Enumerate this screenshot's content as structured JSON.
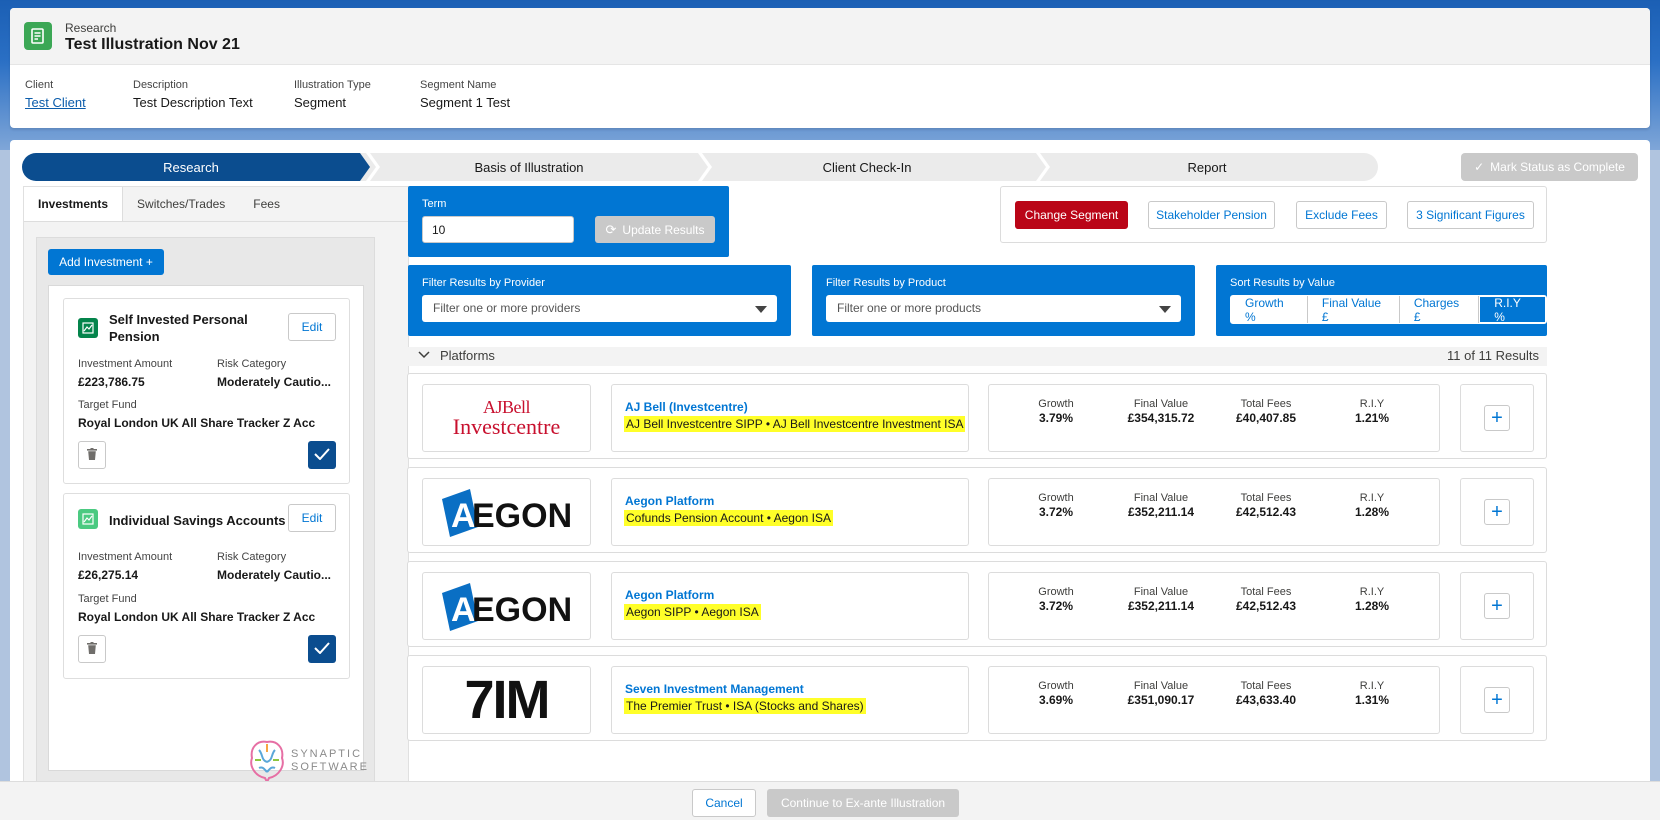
{
  "header": {
    "object_label": "Research",
    "title": "Test Illustration Nov 21",
    "fields": [
      {
        "label": "Client",
        "value": "Test Client"
      },
      {
        "label": "Description",
        "value": "Test Description Text"
      },
      {
        "label": "Illustration Type",
        "value": "Segment"
      },
      {
        "label": "Segment Name",
        "value": "Segment 1 Test"
      }
    ]
  },
  "path": {
    "steps": [
      "Research",
      "Basis of Illustration",
      "Client Check-In",
      "Report"
    ],
    "complete_label": "Mark Status as Complete"
  },
  "left_tabs": [
    "Investments",
    "Switches/Trades",
    "Fees"
  ],
  "add_investment_label": "Add Investment +",
  "investments": [
    {
      "title": "Self Invested Personal Pension",
      "edit_label": "Edit",
      "amount_label": "Investment Amount",
      "amount": "£223,786.75",
      "risk_label": "Risk Category",
      "risk": "Moderately Cautio...",
      "fund_label": "Target Fund",
      "fund": "Royal London UK All Share Tracker Z Acc",
      "icon_color": "#04844b"
    },
    {
      "title": "Individual Savings Accounts",
      "edit_label": "Edit",
      "amount_label": "Investment Amount",
      "amount": "£26,275.14",
      "risk_label": "Risk Category",
      "risk": "Moderately Cautio...",
      "fund_label": "Target Fund",
      "fund": "Royal London UK All Share Tracker Z Acc",
      "icon_color": "#4bca81"
    }
  ],
  "synaptic_logo": {
    "line1": "SYNAPTIC",
    "line2": "SOFTWARE"
  },
  "term": {
    "label": "Term",
    "value": "10",
    "update_label": "Update Results"
  },
  "filter_provider": {
    "label": "Filter Results by Provider",
    "placeholder": "Filter one or more providers"
  },
  "filter_product": {
    "label": "Filter Results by Product",
    "placeholder": "Filter one or more products"
  },
  "sort": {
    "label": "Sort Results by Value",
    "options": [
      "Growth %",
      "Final Value £",
      "Charges £",
      "R.I.Y %"
    ],
    "selected": "R.I.Y %"
  },
  "actions": {
    "change_segment": "Change Segment",
    "stakeholder": "Stakeholder Pension",
    "exclude_fees": "Exclude Fees",
    "sig_figs": "3 Significant Figures"
  },
  "platforms": {
    "title": "Platforms",
    "count": "11 of 11 Results"
  },
  "stat_labels": {
    "growth": "Growth",
    "final": "Final Value",
    "fees": "Total Fees",
    "riy": "R.I.Y"
  },
  "results": [
    {
      "logo": "ajbell",
      "logo_text1": "AJBell",
      "logo_text2": "Investcentre",
      "name": "AJ Bell (Investcentre)",
      "products": "AJ Bell Investcentre SIPP • AJ Bell Investcentre Investment ISA",
      "growth": "3.79%",
      "final": "£354,315.72",
      "fees": "£40,407.85",
      "riy": "1.21%"
    },
    {
      "logo": "aegon",
      "logo_text1": "AEGON",
      "name": "Aegon Platform",
      "products": "Cofunds Pension Account • Aegon ISA",
      "growth": "3.72%",
      "final": "£352,211.14",
      "fees": "£42,512.43",
      "riy": "1.28%"
    },
    {
      "logo": "aegon",
      "logo_text1": "AEGON",
      "name": "Aegon Platform",
      "products": "Aegon SIPP • Aegon ISA",
      "growth": "3.72%",
      "final": "£352,211.14",
      "fees": "£42,512.43",
      "riy": "1.28%"
    },
    {
      "logo": "7im",
      "logo_text1": "7IM",
      "name": "Seven Investment Management",
      "products": "The Premier Trust • ISA (Stocks and Shares)",
      "growth": "3.69%",
      "final": "£351,090.17",
      "fees": "£43,633.40",
      "riy": "1.31%"
    }
  ],
  "footer": {
    "cancel": "Cancel",
    "continue": "Continue to Ex-ante Illustration"
  },
  "colors": {
    "brand_blue": "#0176d3",
    "path_active": "#0b4d8f",
    "danger": "#ba0517",
    "highlight": "#ffff29"
  }
}
